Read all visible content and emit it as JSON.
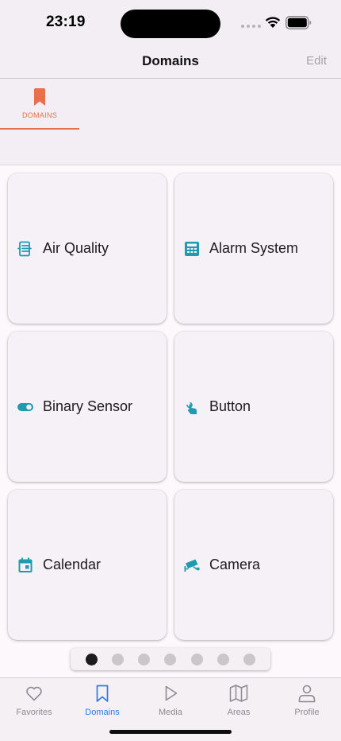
{
  "status_bar": {
    "time": "23:19"
  },
  "nav": {
    "title": "Domains",
    "edit_label": "Edit"
  },
  "top_tabs": [
    {
      "label": "DOMAINS",
      "icon": "bookmark-icon"
    }
  ],
  "domains": [
    {
      "label": "Air Quality",
      "icon": "air-quality-icon"
    },
    {
      "label": "Alarm System",
      "icon": "alarm-panel-icon"
    },
    {
      "label": "Binary Sensor",
      "icon": "toggle-switch-icon"
    },
    {
      "label": "Button",
      "icon": "gesture-tap-icon"
    },
    {
      "label": "Calendar",
      "icon": "calendar-icon"
    },
    {
      "label": "Camera",
      "icon": "cctv-icon"
    }
  ],
  "pager": {
    "pages": 7,
    "active_page": 1
  },
  "tab_bar": [
    {
      "label": "Favorites",
      "icon": "heart-icon"
    },
    {
      "label": "Domains",
      "icon": "bookmark-icon",
      "active": true
    },
    {
      "label": "Media",
      "icon": "play-icon"
    },
    {
      "label": "Areas",
      "icon": "map-icon"
    },
    {
      "label": "Profile",
      "icon": "person-icon"
    }
  ],
  "colors": {
    "accent_orange": "#e8704a",
    "icon_teal": "#1f9bb0",
    "tab_active_blue": "#2f7ae0",
    "background": "#fdf8fb",
    "card": "#f6f1f6"
  }
}
